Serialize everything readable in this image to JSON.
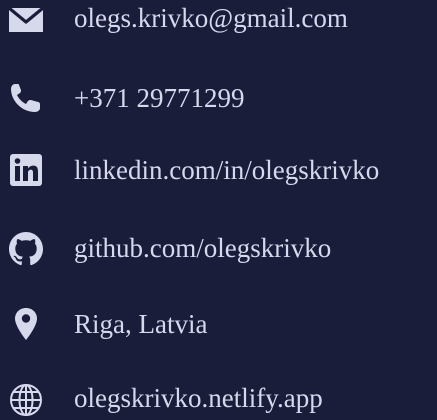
{
  "theme": {
    "background": "#1a1d3a",
    "text": "#d6d8ec",
    "icon": "#d6d8ec"
  },
  "contacts": [
    {
      "icon": "envelope-icon",
      "text": "olegs.krivko@gmail.com"
    },
    {
      "icon": "phone-icon",
      "text": "+371 29771299"
    },
    {
      "icon": "linkedin-icon",
      "text": "linkedin.com/in/olegskrivko"
    },
    {
      "icon": "github-icon",
      "text": "github.com/olegskrivko"
    },
    {
      "icon": "map-pin-icon",
      "text": "Riga, Latvia"
    },
    {
      "icon": "globe-icon",
      "text": "olegskrivko.netlify.app"
    }
  ]
}
